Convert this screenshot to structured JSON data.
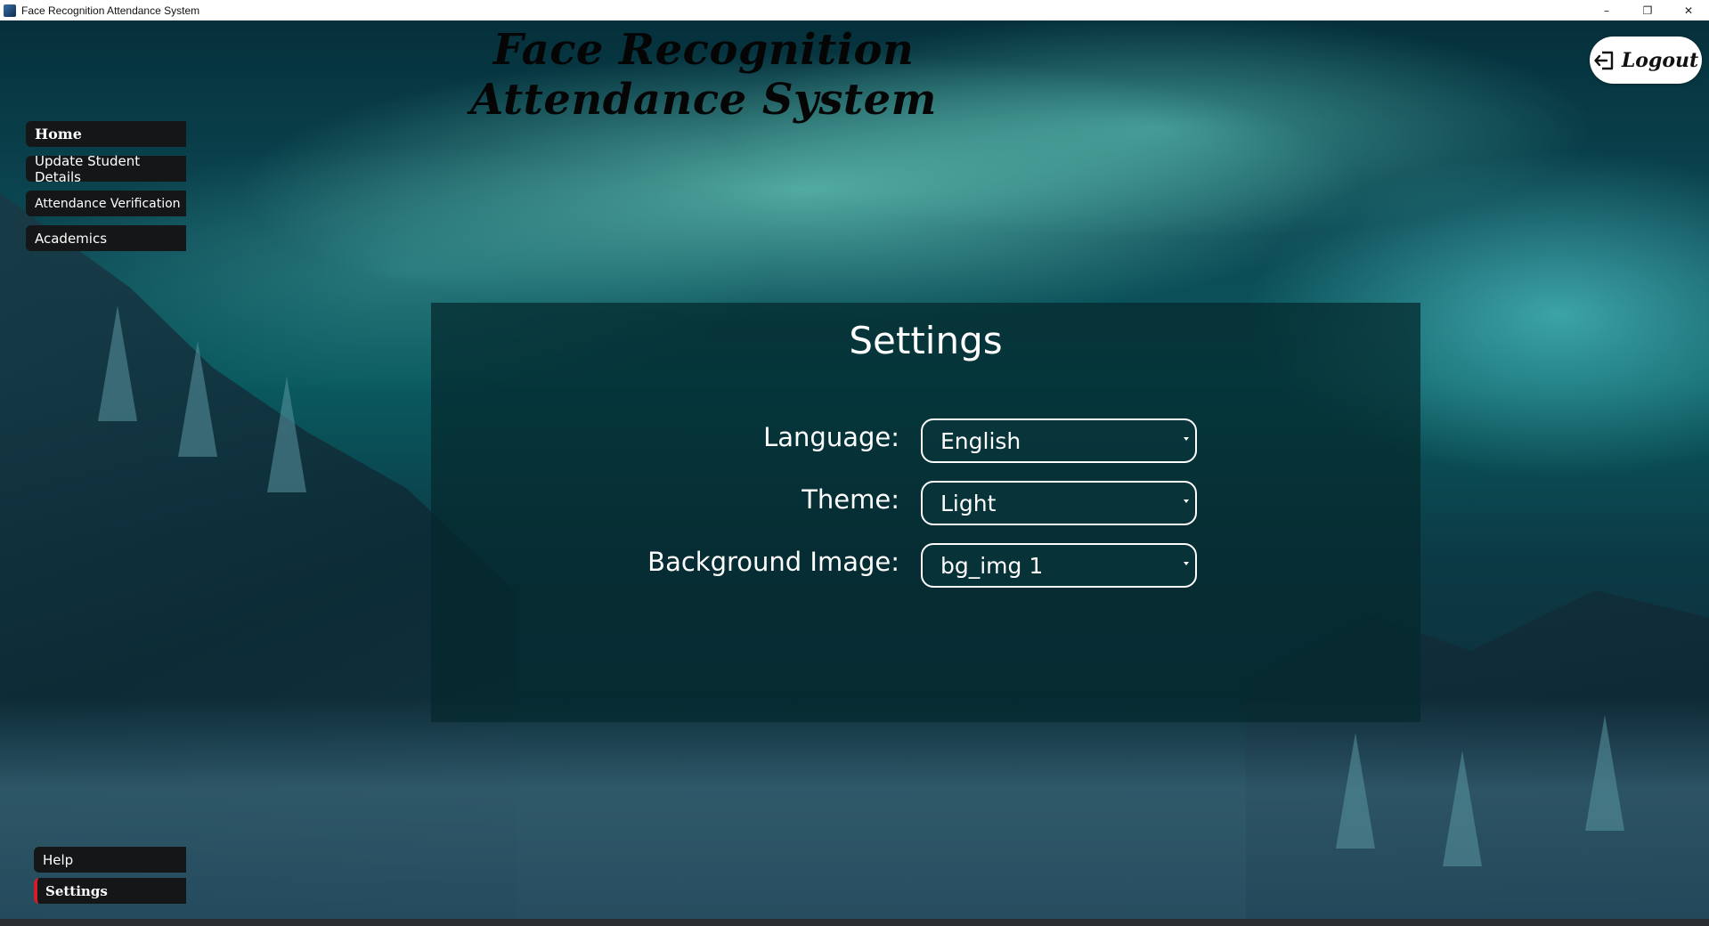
{
  "window": {
    "title": "Face Recognition Attendance System",
    "controls": {
      "minimize": "–",
      "restore": "❐",
      "close": "✕"
    }
  },
  "header": {
    "title": "Face Recognition Attendance System",
    "logout_label": "Logout"
  },
  "sidebar": {
    "items": [
      {
        "label": "Home"
      },
      {
        "label": "Update Student Details"
      },
      {
        "label": "Attendance Verification"
      },
      {
        "label": "Academics"
      }
    ],
    "bottom_items": [
      {
        "label": "Help"
      },
      {
        "label": "Settings"
      }
    ],
    "active": "Settings"
  },
  "settings": {
    "title": "Settings",
    "language": {
      "label": "Language:",
      "value": "English"
    },
    "theme": {
      "label": "Theme:",
      "value": "Light"
    },
    "background": {
      "label": "Background Image:",
      "value": "bg_img 1"
    }
  },
  "colors": {
    "nav_bg": "#141618",
    "active_indicator": "#d11e2a",
    "panel_bg": "#04282c"
  }
}
